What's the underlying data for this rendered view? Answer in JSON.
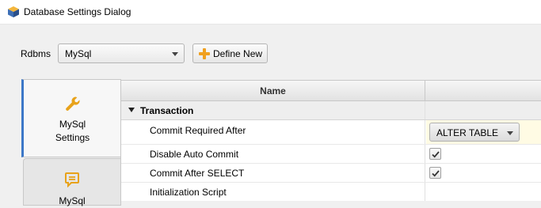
{
  "window": {
    "title": "Database Settings Dialog",
    "icon": "app-cube-icon"
  },
  "toolbar": {
    "rdbms_label": "Rdbms",
    "rdbms_value": "MySql",
    "define_new_label": "Define New",
    "define_new_icon": "plus-icon"
  },
  "tabs": [
    {
      "line1": "MySql",
      "line2": "Settings",
      "icon": "wrench-icon",
      "active": true
    },
    {
      "line1": "MySql",
      "icon": "message-icon",
      "active": false
    }
  ],
  "grid": {
    "header_name": "Name",
    "group": {
      "label": "Transaction",
      "expanded": true
    },
    "rows": [
      {
        "label": "Commit Required After",
        "value": "ALTER TABLE",
        "type": "select"
      },
      {
        "label": "Disable Auto Commit",
        "checked": true,
        "type": "checkbox"
      },
      {
        "label": "Commit After SELECT",
        "checked": true,
        "type": "checkbox"
      },
      {
        "label": "Initialization Script",
        "type": "text"
      }
    ]
  },
  "colors": {
    "accent_orange": "#f0a020",
    "tab_active_border": "#3c78c8"
  }
}
